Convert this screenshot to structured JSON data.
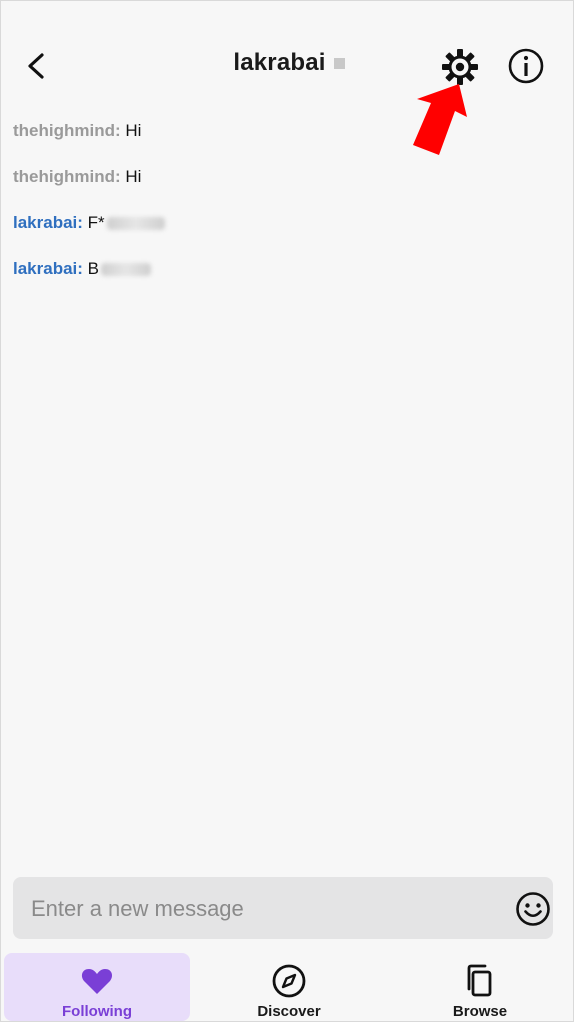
{
  "header": {
    "back_icon": "chevron-left-icon",
    "title": "lakrabai",
    "settings_icon": "gear-icon",
    "info_icon": "info-icon",
    "annotation": "red-arrow-pointing-to-settings"
  },
  "messages": [
    {
      "user": "thehighmind",
      "separator": ":",
      "text": "Hi",
      "role": "other",
      "redacted": false
    },
    {
      "user": "thehighmind",
      "separator": ":",
      "text": "Hi",
      "role": "other",
      "redacted": false
    },
    {
      "user": "lakrabai",
      "separator": ":",
      "text": "F*",
      "role": "self",
      "redacted": true
    },
    {
      "user": "lakrabai",
      "separator": ":",
      "text": "B",
      "role": "self",
      "redacted": true
    }
  ],
  "composer": {
    "placeholder": "Enter a new message",
    "emoji_icon": "smiley-icon"
  },
  "tabs": [
    {
      "label": "Following",
      "icon": "heart-icon",
      "active": true
    },
    {
      "label": "Discover",
      "icon": "compass-icon",
      "active": false
    },
    {
      "label": "Browse",
      "icon": "copy-icon",
      "active": false
    }
  ],
  "colors": {
    "accent": "#7a3fd6",
    "self_user": "#2f6fbf",
    "other_user": "#9a9a9a",
    "annotation_arrow": "#ff0000"
  }
}
